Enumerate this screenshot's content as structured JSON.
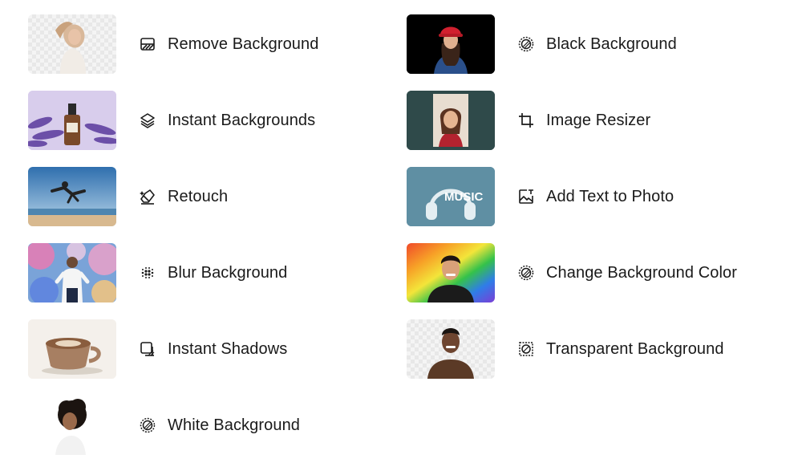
{
  "tools": [
    {
      "id": "remove-background",
      "label": "Remove Background",
      "icon": "eraser-icon"
    },
    {
      "id": "instant-backgrounds",
      "label": "Instant Backgrounds",
      "icon": "layers-sparkle-icon"
    },
    {
      "id": "retouch",
      "label": "Retouch",
      "icon": "retouch-eraser-icon"
    },
    {
      "id": "blur-background",
      "label": "Blur Background",
      "icon": "dots-grid-icon"
    },
    {
      "id": "instant-shadows",
      "label": "Instant Shadows",
      "icon": "shadow-square-icon"
    },
    {
      "id": "white-background",
      "label": "White Background",
      "icon": "sun-gear-icon"
    },
    {
      "id": "black-background",
      "label": "Black Background",
      "icon": "sun-gear-icon"
    },
    {
      "id": "image-resizer",
      "label": "Image Resizer",
      "icon": "crop-icon"
    },
    {
      "id": "add-text-to-photo",
      "label": "Add Text to Photo",
      "icon": "image-text-icon"
    },
    {
      "id": "change-background-color",
      "label": "Change Background Color",
      "icon": "sun-gear-icon"
    },
    {
      "id": "transparent-background",
      "label": "Transparent Background",
      "icon": "transparent-square-icon"
    }
  ],
  "thumb_text": {
    "music": "MUSIC"
  }
}
